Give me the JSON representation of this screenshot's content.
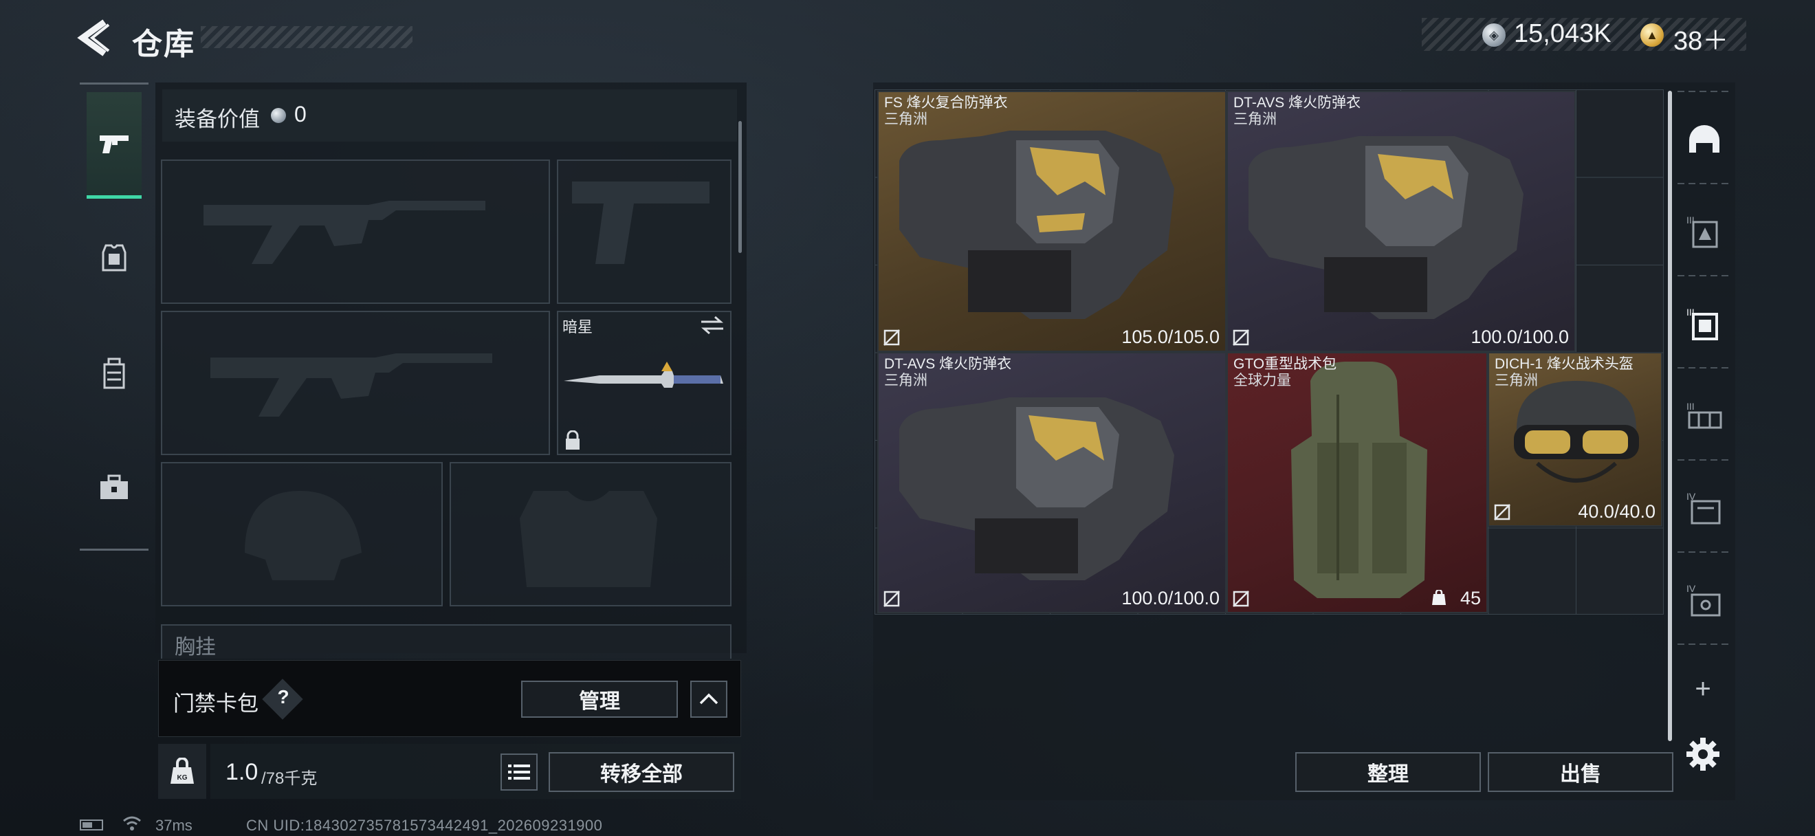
{
  "header": {
    "title": "仓库",
    "money": "15,043K",
    "gold_count": "38＋"
  },
  "nav": {
    "items": [
      "weapons",
      "armor",
      "backpack",
      "case"
    ],
    "active": "weapons"
  },
  "loadout": {
    "value_label": "装备价值",
    "value_amount": "0",
    "melee_name": "暗星",
    "chest_rig_label": "胸挂"
  },
  "keycard": {
    "label": "门禁卡包",
    "help": "?",
    "manage_label": "管理"
  },
  "weight": {
    "current": "1.0",
    "max": "/78千克",
    "transfer_all_label": "转移全部"
  },
  "status": {
    "ping": "37ms",
    "uid": "CN UID:18430273578157344249​1_202609231900"
  },
  "stash": {
    "items": [
      {
        "name": "FS 烽火复合防弹衣",
        "sub": "三角洲",
        "value": "105.0/105.0",
        "bg": "#5a4830"
      },
      {
        "name": "DT-AVS 烽火防弹衣",
        "sub": "三角洲",
        "value": "100.0/100.0",
        "bg": "#34323f"
      },
      {
        "name": "DT-AVS 烽火防弹衣",
        "sub": "三角洲",
        "value": "100.0/100.0",
        "bg": "#34323f"
      },
      {
        "name": "GTO重型战术包",
        "sub": "全球力量",
        "value": "45",
        "bg": "#52202a"
      },
      {
        "name": "DICH-1 烽火战术头盔",
        "sub": "三角洲",
        "value": "40.0/40.0",
        "bg": "#5a4830"
      }
    ],
    "sort_label": "整理",
    "sell_label": "出售"
  },
  "colors": {
    "accent": "#3fd7a6",
    "gold_bg": "#5a4830",
    "purple_bg": "#34323f",
    "red_bg": "#52202a"
  }
}
